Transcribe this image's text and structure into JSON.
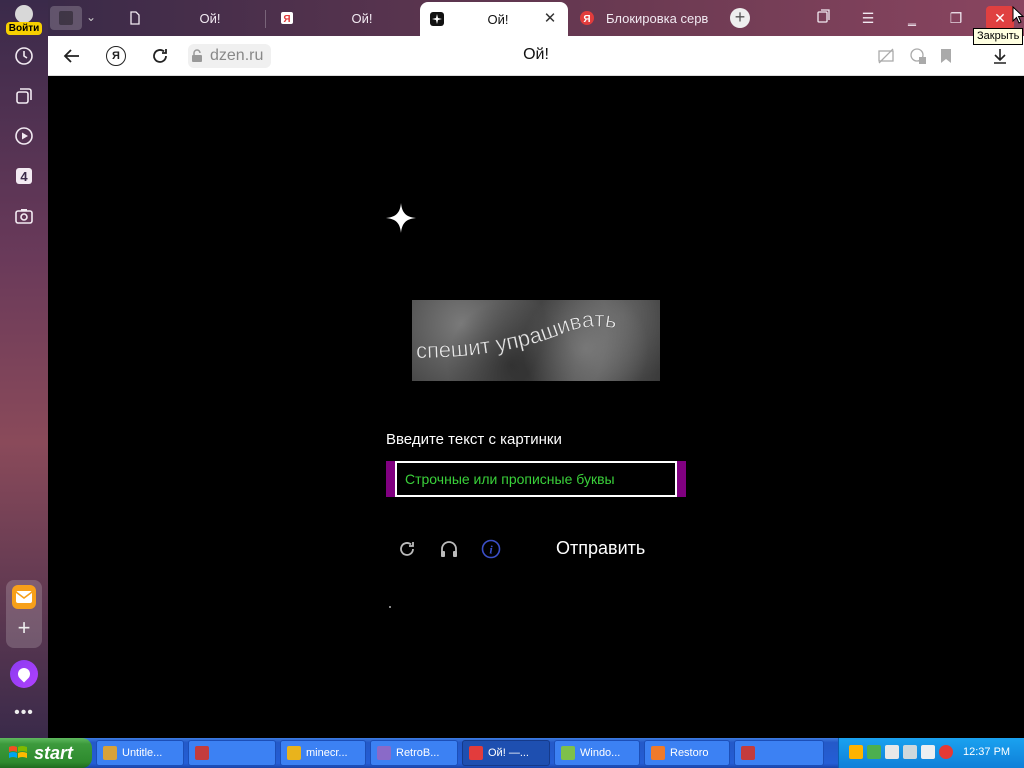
{
  "sidebar": {
    "login_label": "Войти",
    "icons": [
      "history-icon",
      "collections-icon",
      "video-icon",
      "number-four-icon",
      "screenshot-icon"
    ]
  },
  "tabs": [
    {
      "title": "Ой!",
      "favicon": "page-icon",
      "active": false
    },
    {
      "title": "Ой!",
      "favicon": "yandex-ya-icon",
      "active": false
    },
    {
      "title": "Ой!",
      "favicon": "sparkle-icon",
      "active": true
    },
    {
      "title": "Блокировка серв",
      "favicon": "yandex-red-icon",
      "active": false
    }
  ],
  "tooltip": "Закрыть",
  "address": {
    "url": "dzen.ru",
    "page_title": "Ой!",
    "yandex_button": "Я"
  },
  "captcha": {
    "image_text": "спешит упрашивать",
    "prompt": "Введите текст с картинки",
    "placeholder": "Строчные или прописные буквы",
    "submit_label": "Отправить"
  },
  "taskbar": {
    "start_label": "start",
    "tasks": [
      {
        "label": "Untitle...",
        "color": "#d8a23a"
      },
      {
        "label": "",
        "color": "#c43c3c"
      },
      {
        "label": "minecr...",
        "color": "#e9b31c"
      },
      {
        "label": "RetroB...",
        "color": "#8a6ac8"
      },
      {
        "label": "Ой! —...",
        "color": "#e23c3c"
      },
      {
        "label": "Windo...",
        "color": "#7ec04a"
      },
      {
        "label": "Restoro",
        "color": "#f07a2a"
      },
      {
        "label": "",
        "color": "#c43c3c"
      }
    ],
    "clock": "12:37 PM"
  },
  "colors": {
    "accent_purple": "#800080",
    "placeholder_green": "#3ad13a",
    "close_red": "#e04040"
  }
}
